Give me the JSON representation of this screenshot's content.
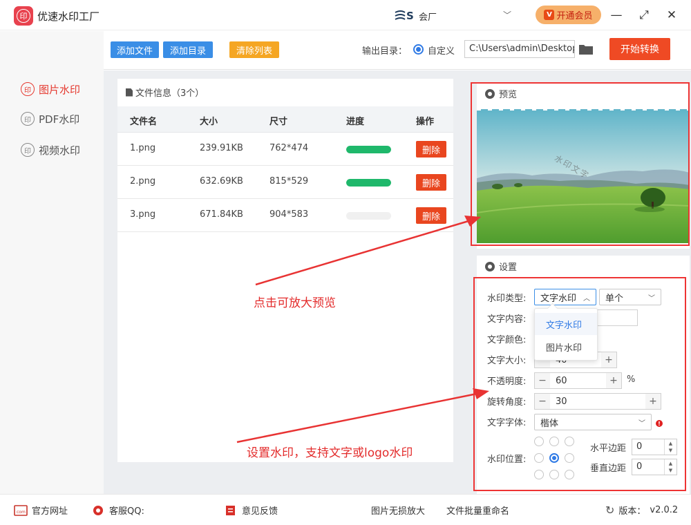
{
  "app": {
    "title": "优速水印工厂",
    "logo_text": "印"
  },
  "user": {
    "name": "会厂"
  },
  "vip": {
    "label": "开通会员",
    "icon": "V"
  },
  "window": {
    "minimize": "—",
    "maximize": "⤢",
    "close": "✕"
  },
  "sidebar": {
    "items": [
      {
        "label": "图片水印",
        "icon": "印",
        "active": true
      },
      {
        "label": "PDF水印",
        "icon": "印",
        "active": false
      },
      {
        "label": "视频水印",
        "icon": "印",
        "active": false
      }
    ]
  },
  "toolbar": {
    "add_file": "添加文件",
    "add_dir": "添加目录",
    "clear_list": "清除列表",
    "output_label": "输出目录：",
    "output_option": "自定义",
    "output_path": "C:\\Users\\admin\\Desktop",
    "start_button": "开始转换"
  },
  "files": {
    "title": "文件信息（3个）",
    "columns": [
      "文件名",
      "大小",
      "尺寸",
      "进度",
      "操作"
    ],
    "rows": [
      {
        "name": "1.png",
        "size": "239.91KB",
        "dims": "762*474",
        "progress": 1.0,
        "action": "删除"
      },
      {
        "name": "2.png",
        "size": "632.69KB",
        "dims": "815*529",
        "progress": 1.0,
        "action": "删除"
      },
      {
        "name": "3.png",
        "size": "671.84KB",
        "dims": "904*583",
        "progress": 0.0,
        "action": "删除"
      }
    ]
  },
  "preview": {
    "title": "预览",
    "watermark_text": "水印文字"
  },
  "settings": {
    "title": "设置",
    "type_label": "水印类型:",
    "type_value": "文字水印",
    "mode_value": "单个",
    "content_label": "文字内容:",
    "color_label": "文字颜色:",
    "size_label": "文字大小:",
    "size_value": "40",
    "opacity_label": "不透明度:",
    "opacity_value": "60",
    "opacity_unit": "%",
    "rotation_label": "旋转角度:",
    "rotation_value": "30",
    "font_label": "文字字体:",
    "font_value": "楷体",
    "position_label": "水印位置:",
    "position_selected_index": 4,
    "h_margin_label": "水平边距",
    "h_margin_value": "0",
    "v_margin_label": "垂直边距",
    "v_margin_value": "0",
    "dropdown_options": [
      "文字水印",
      "图片水印"
    ]
  },
  "annotations": {
    "preview_note": "点击可放大预览",
    "settings_note": "设置水印，支持文字或logo水印"
  },
  "footer": {
    "website": "官方网址",
    "support": "客服QQ:",
    "feedback": "意见反馈",
    "enlarge": "图片无损放大",
    "rename": "文件批量重命名",
    "version_label": "版本：",
    "version_value": "v2.0.2"
  }
}
